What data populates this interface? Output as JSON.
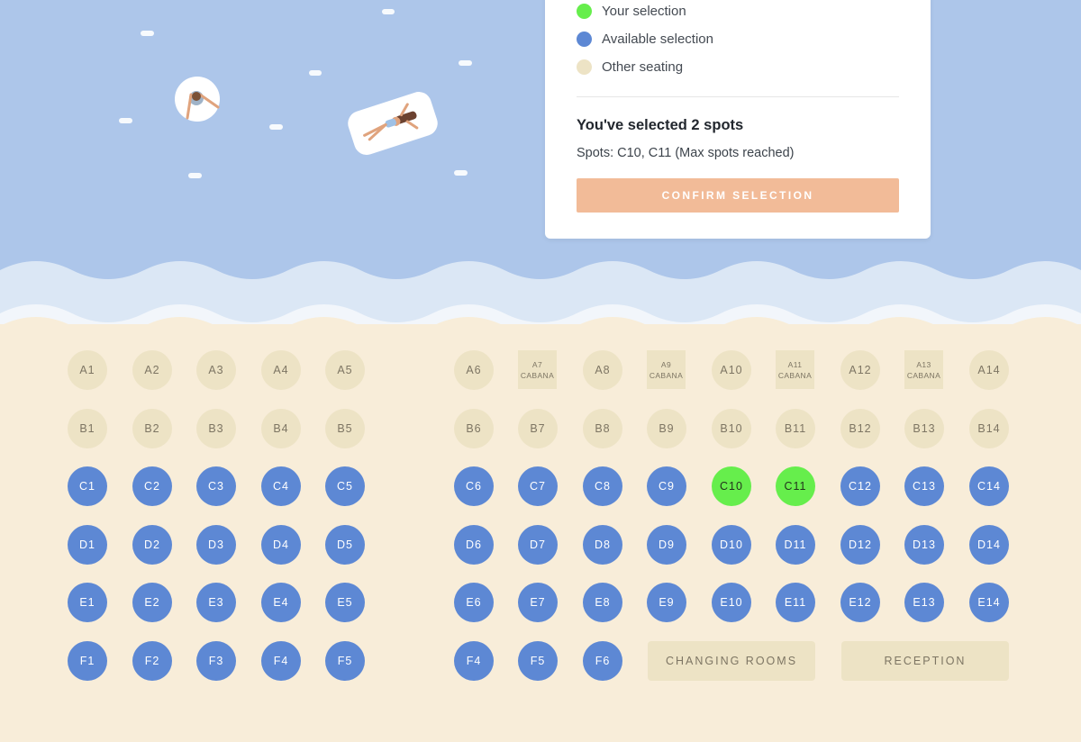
{
  "colors": {
    "your_selection": "#66ee4c",
    "available": "#5d88d4",
    "other": "#ede3c5",
    "confirm": "#f2bb98",
    "sea": "#adc6ea",
    "sand": "#f8edd9"
  },
  "legend": {
    "your_selection": "Your selection",
    "available": "Available selection",
    "other": "Other seating"
  },
  "summary": {
    "title": "You've selected 2 spots",
    "spots": "Spots: C10, C11 (Max spots reached)",
    "confirm_label": "CONFIRM SELECTION"
  },
  "cabana_label": "CABANA",
  "rows": [
    {
      "row": "A",
      "status": "other",
      "seats": [
        "A1",
        "A2",
        "A3",
        "A4",
        "A5",
        "A6",
        "A7",
        "A8",
        "A9",
        "A10",
        "A11",
        "A12",
        "A13",
        "A14"
      ],
      "cabanas": [
        "A7",
        "A9",
        "A11",
        "A13"
      ]
    },
    {
      "row": "B",
      "status": "other",
      "seats": [
        "B1",
        "B2",
        "B3",
        "B4",
        "B5",
        "B6",
        "B7",
        "B8",
        "B9",
        "B10",
        "B11",
        "B12",
        "B13",
        "B14"
      ],
      "cabanas": []
    },
    {
      "row": "C",
      "status": "available",
      "seats": [
        "C1",
        "C2",
        "C3",
        "C4",
        "C5",
        "C6",
        "C7",
        "C8",
        "C9",
        "C10",
        "C11",
        "C12",
        "C13",
        "C14"
      ],
      "cabanas": [],
      "selected": [
        "C10",
        "C11"
      ]
    },
    {
      "row": "D",
      "status": "available",
      "seats": [
        "D1",
        "D2",
        "D3",
        "D4",
        "D5",
        "D6",
        "D7",
        "D8",
        "D9",
        "D10",
        "D11",
        "D12",
        "D13",
        "D14"
      ],
      "cabanas": []
    },
    {
      "row": "E",
      "status": "available",
      "seats": [
        "E1",
        "E2",
        "E3",
        "E4",
        "E5",
        "E6",
        "E7",
        "E8",
        "E9",
        "E10",
        "E11",
        "E12",
        "E13",
        "E14"
      ],
      "cabanas": []
    },
    {
      "row": "F",
      "status": "available",
      "seats": [
        "F1",
        "F2",
        "F3",
        "F4",
        "F5",
        "F4",
        "F5",
        "F6"
      ],
      "cabanas": []
    }
  ],
  "facilities": [
    "CHANGING ROOMS",
    "RECEPTION"
  ]
}
